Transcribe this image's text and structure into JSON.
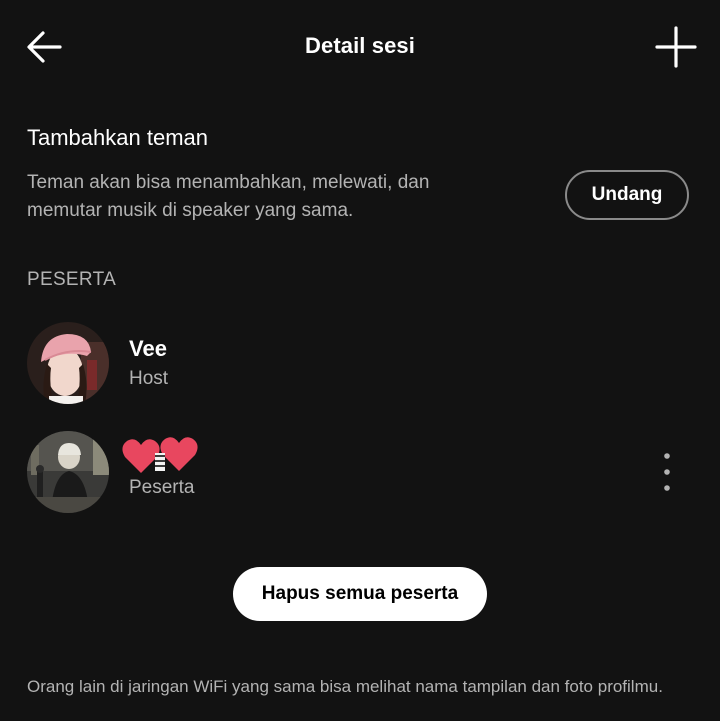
{
  "header": {
    "title": "Detail sesi",
    "back_icon": "arrow-left-icon",
    "add_icon": "plus-icon"
  },
  "invite_section": {
    "title": "Tambahkan teman",
    "description": "Teman akan bisa menambahkan, melewati, dan memutar musik di speaker yang sama.",
    "button_label": "Undang"
  },
  "participants": {
    "label": "PESERTA",
    "items": [
      {
        "name": "Vee",
        "role": "Host"
      },
      {
        "name": "❤️🦓❤️",
        "role": "Peserta"
      }
    ]
  },
  "actions": {
    "remove_all_label": "Hapus semua peserta"
  },
  "footer": {
    "note": "Orang lain di jaringan WiFi yang sama bisa melihat nama tampilan dan foto profilmu."
  },
  "colors": {
    "background": "#121212",
    "text_primary": "#ffffff",
    "text_secondary": "#b3b3b3",
    "heart": "#e8475f"
  }
}
